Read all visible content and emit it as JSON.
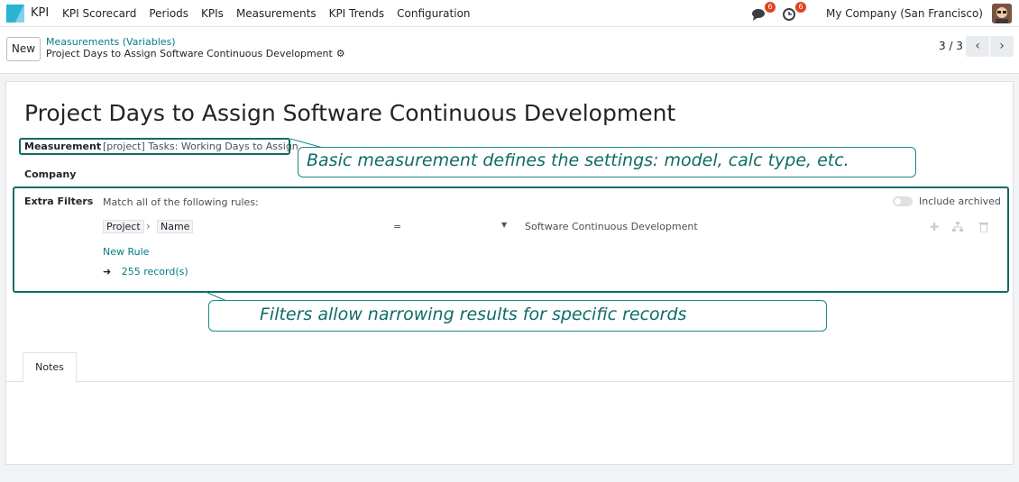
{
  "app": {
    "name": "KPI"
  },
  "menu": [
    "KPI Scorecard",
    "Periods",
    "KPIs",
    "Measurements",
    "KPI Trends",
    "Configuration"
  ],
  "systray": {
    "messages_badge": "6",
    "activities_badge": "6",
    "company": "My Company (San Francisco)"
  },
  "control_panel": {
    "new_label": "New",
    "breadcrumb_parent": "Measurements (Variables)",
    "breadcrumb_current": "Project Days to Assign Software Continuous Development",
    "pager": "3 / 3"
  },
  "form": {
    "title": "Project Days to Assign Software Continuous Development",
    "measurement_label": "Measurement",
    "measurement_value": "[project] Tasks: Working Days to Assign",
    "company_label": "Company",
    "extra_filters_label": "Extra Filters",
    "match_text": "Match all of the following rules:",
    "include_archived": "Include archived",
    "rule": {
      "path_1": "Project",
      "path_2": "Name",
      "operator": "=",
      "value": "Software Continuous Development"
    },
    "new_rule": "New Rule",
    "records": "255 record(s)"
  },
  "annotations": {
    "measurement": "Basic measurement defines the settings: model, calc type, etc.",
    "filters": "Filters allow narrowing results for specific records"
  },
  "tabs": [
    "Notes"
  ],
  "colors": {
    "accent": "#017e84",
    "annotation": "#0f6b67",
    "badge": "#e2411f"
  }
}
